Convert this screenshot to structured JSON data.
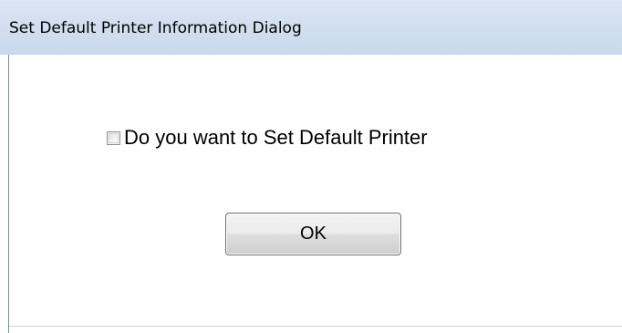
{
  "window": {
    "title": "Set Default Printer Information Dialog"
  },
  "form": {
    "checkbox_label": "Do you want to Set Default Printer",
    "checkbox_checked": false,
    "ok_label": "OK"
  },
  "colors": {
    "titlebar": "#d2dff0",
    "background": "#ffffff",
    "button_border": "#707070"
  }
}
